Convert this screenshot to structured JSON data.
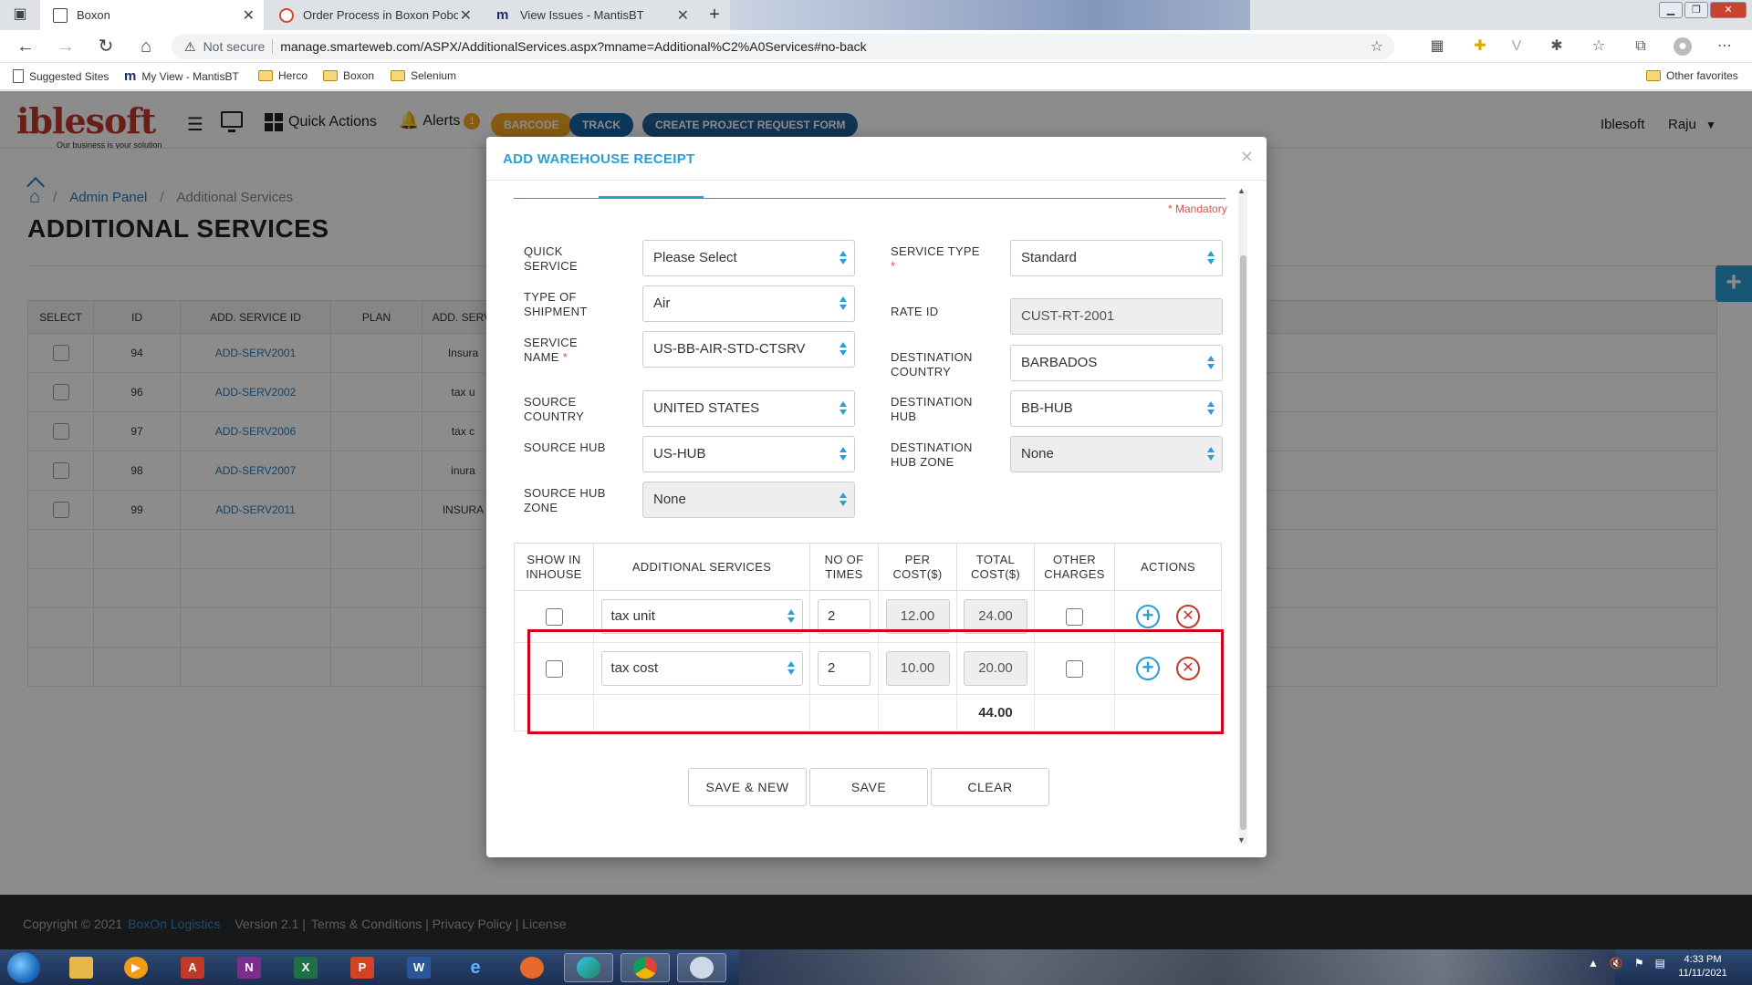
{
  "browser": {
    "tabs": [
      {
        "title": "Boxon",
        "active": true
      },
      {
        "title": "Order Process in Boxon Pobox So",
        "active": false
      },
      {
        "title": "View Issues - MantisBT",
        "active": false
      }
    ],
    "security_label": "Not secure",
    "url": "manage.smarteweb.com/ASPX/AdditionalServices.aspx?mname=Additional%C2%A0Services#no-back",
    "bookmarks": [
      "Suggested Sites",
      "My View - MantisBT",
      "Herco",
      "Boxon",
      "Selenium"
    ],
    "other_favorites": "Other favorites"
  },
  "app_header": {
    "logo_text": "iblesoft",
    "logo_tagline": "Our business is your solution",
    "quick_actions": "Quick Actions",
    "alerts_label": "Alerts",
    "alerts_count": "1",
    "pills": [
      "BARCODE",
      "TRACK",
      "CREATE PROJECT REQUEST FORM"
    ],
    "org": "Iblesoft",
    "user": "Raju"
  },
  "page": {
    "breadcrumb": [
      "Admin Panel",
      "Additional Services"
    ],
    "title": "ADDITIONAL SERVICES",
    "table_headers": [
      "SELECT",
      "ID",
      "ADD. SERVICE ID",
      "PLAN",
      "ADD. SERVI"
    ],
    "rows": [
      {
        "id": "94",
        "service_id": "ADD-SERV2001",
        "plan": "",
        "name": "Insura"
      },
      {
        "id": "96",
        "service_id": "ADD-SERV2002",
        "plan": "",
        "name": "tax u"
      },
      {
        "id": "97",
        "service_id": "ADD-SERV2006",
        "plan": "",
        "name": "tax c"
      },
      {
        "id": "98",
        "service_id": "ADD-SERV2007",
        "plan": "",
        "name": "inura"
      },
      {
        "id": "99",
        "service_id": "ADD-SERV2011",
        "plan": "",
        "name": "INSURA"
      }
    ]
  },
  "footer": {
    "copyright": "Copyright © 2021",
    "brand": "BoxOn Logistics",
    "version": "Version 2.1 |",
    "links": "Terms & Conditions | Privacy Policy | License"
  },
  "modal": {
    "title": "ADD WAREHOUSE RECEIPT",
    "mandatory": "* Mandatory",
    "left_fields": [
      {
        "label": "QUICK SERVICE",
        "value": "Please Select",
        "required": false,
        "disabled": false
      },
      {
        "label": "TYPE OF SHIPMENT",
        "value": "Air",
        "required": false,
        "disabled": false
      },
      {
        "label": "SERVICE NAME",
        "value": "US-BB-AIR-STD-CTSRV",
        "required": true,
        "disabled": false
      },
      {
        "label": "SOURCE COUNTRY",
        "value": "UNITED STATES",
        "required": false,
        "disabled": false
      },
      {
        "label": "SOURCE HUB",
        "value": "US-HUB",
        "required": false,
        "disabled": false
      },
      {
        "label": "SOURCE HUB ZONE",
        "value": "None",
        "required": false,
        "disabled": true
      }
    ],
    "right_fields": [
      {
        "label": "SERVICE TYPE",
        "value": "Standard",
        "required": true,
        "disabled": false
      },
      {
        "label": "RATE ID",
        "value": "CUST-RT-2001",
        "required": false,
        "disabled": true
      },
      {
        "label": "DESTINATION COUNTRY",
        "value": "BARBADOS",
        "required": false,
        "disabled": false
      },
      {
        "label": "DESTINATION HUB",
        "value": "BB-HUB",
        "required": false,
        "disabled": false
      },
      {
        "label": "DESTINATION HUB ZONE",
        "value": "None",
        "required": false,
        "disabled": true
      }
    ],
    "services_table": {
      "headers": [
        "SHOW IN INHOUSE",
        "ADDITIONAL SERVICES",
        "NO OF TIMES",
        "PER COST($)",
        "TOTAL COST($)",
        "OTHER CHARGES",
        "ACTIONS"
      ],
      "rows": [
        {
          "service": "tax unit",
          "times": "2",
          "per_cost": "12.00",
          "total_cost": "24.00"
        },
        {
          "service": "tax cost",
          "times": "2",
          "per_cost": "10.00",
          "total_cost": "20.00"
        }
      ],
      "grand_total": "44.00"
    },
    "buttons": [
      "SAVE & NEW",
      "SAVE",
      "CLEAR"
    ]
  },
  "taskbar": {
    "time": "4:33 PM",
    "date": "11/11/2021"
  },
  "colors": {
    "accent": "#2a9fd6",
    "danger": "#c0392b",
    "highlight": "#d0021b"
  }
}
